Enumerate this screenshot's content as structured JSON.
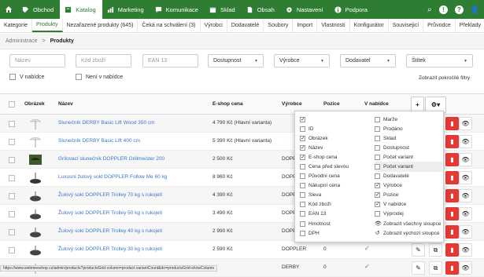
{
  "topnav": {
    "items": [
      {
        "label": "",
        "icon": "home-icon"
      },
      {
        "label": "Obchod",
        "icon": "tag-icon"
      },
      {
        "label": "Katalog",
        "icon": "book-icon",
        "active": true
      },
      {
        "label": "Marketing",
        "icon": "chart-icon"
      },
      {
        "label": "Komunikace",
        "icon": "chat-icon"
      },
      {
        "label": "Sklad",
        "icon": "box-icon"
      },
      {
        "label": "Obsah",
        "icon": "file-icon"
      },
      {
        "label": "Nastavení",
        "icon": "gear-icon"
      },
      {
        "label": "Podpora",
        "icon": "info-icon"
      }
    ],
    "right": [
      {
        "label": "Q",
        "icon": "search-icon"
      },
      {
        "label": "!",
        "icon": "alert-icon"
      },
      {
        "label": "?",
        "icon": "help-icon"
      },
      {
        "label": "👤",
        "icon": "user-icon"
      }
    ]
  },
  "subnav": {
    "items": [
      "Kategorie",
      "Produkty",
      "Nezařazené produkty (645)",
      "Čeká na schválení (3)",
      "Výrobci",
      "Dodavatelé",
      "Soubory",
      "Import",
      "Vlastnosti",
      "Konfigurátor",
      "Souvisejicí",
      "Průvodce",
      "Překlady"
    ],
    "active_index": 1
  },
  "breadcrumb": {
    "root": "Administrace",
    "sep": ">",
    "current": "Produkty"
  },
  "filters": {
    "name_placeholder": "Název",
    "code_placeholder": "Kód zboží",
    "ean_placeholder": "EAN 13",
    "availability": "Dostupnost",
    "manufacturer": "Výrobce",
    "supplier": "Dodavatel",
    "label": "Štítek",
    "in_offer": "V nabídce",
    "not_in_offer": "Není v nabídce",
    "advanced": "Zobrazit pokročilé filtry"
  },
  "table": {
    "headers": {
      "image": "Obrázek",
      "name": "Název",
      "price": "E-shop cena",
      "manufacturer": "Výrobce",
      "position": "Pozice",
      "in_offer": "V nabídce",
      "add": "+",
      "settings": "⚙▾"
    },
    "rows": [
      {
        "name": "Slunečník DERBY Basic Lift Wood 350 cm",
        "price": "4 790 Kč (Hlavní varianta)",
        "manufacturer": "",
        "position": "",
        "thumb": "parasol"
      },
      {
        "name": "Slunečník DERBY Basic Lift 400 cm",
        "price": "5 390 Kč (Hlavní varianta)",
        "manufacturer": "",
        "position": "",
        "thumb": "parasol"
      },
      {
        "name": "Grilovací slunečník DOPPLER Grillmeister 200",
        "price": "2 500 Kč",
        "manufacturer": "DOPPL",
        "position": "",
        "thumb": "grill"
      },
      {
        "name": "Luxusní žulový sokl DOPPLER Follow Me 60 kg",
        "price": "8 960 Kč",
        "manufacturer": "DOPPL",
        "position": "",
        "thumb": "base"
      },
      {
        "name": "Žulový sokl DOPPLER Trolley 70 kg s rukojetí",
        "price": "4 390 Kč",
        "manufacturer": "DOPPL",
        "position": "",
        "thumb": "base"
      },
      {
        "name": "Žulový sokl DOPPLER Trolley 50 kg s rukojetí",
        "price": "3 490 Kč",
        "manufacturer": "DOPPL",
        "position": "",
        "thumb": "base"
      },
      {
        "name": "Žulový sokl DOPPLER Trolley 40 kg s rukojetí",
        "price": "2 990 Kč",
        "manufacturer": "DOPPL",
        "position": "",
        "thumb": "base"
      },
      {
        "name": "Žulový sokl DOPPLER Trolley 30 kg s rukojetí",
        "price": "2 590 Kč",
        "manufacturer": "DOPPLER",
        "position": "0",
        "thumb": "base"
      },
      {
        "name": "",
        "price": "",
        "manufacturer": "DERBY",
        "position": "0",
        "thumb": "parasol"
      }
    ]
  },
  "columns_dropdown": {
    "left": [
      {
        "label": "",
        "checked": true
      },
      {
        "label": "ID",
        "checked": false
      },
      {
        "label": "Obrázek",
        "checked": true
      },
      {
        "label": "Název",
        "checked": true
      },
      {
        "label": "E-shop cena",
        "checked": true
      },
      {
        "label": "Cena před slevou",
        "checked": false
      },
      {
        "label": "Původní cena",
        "checked": false
      },
      {
        "label": "Nákupní cena",
        "checked": false
      },
      {
        "label": "Sleva",
        "checked": false
      },
      {
        "label": "Kód zboží",
        "checked": false
      },
      {
        "label": "EAN 13",
        "checked": false
      },
      {
        "label": "Hmotnost",
        "checked": false
      },
      {
        "label": "DPH",
        "checked": false
      }
    ],
    "right": [
      {
        "label": "Marže",
        "checked": false
      },
      {
        "label": "Prodáno",
        "checked": false
      },
      {
        "label": "Sklad",
        "checked": false
      },
      {
        "label": "Dostupnost",
        "checked": false
      },
      {
        "label": "Počet variant",
        "checked": false
      },
      {
        "label": "Počet variant",
        "checked": false,
        "highlight": true
      },
      {
        "label": "Dodavatelé",
        "checked": false
      },
      {
        "label": "Výrobce",
        "checked": true
      },
      {
        "label": "Pozice",
        "checked": true
      },
      {
        "label": "V nabídce",
        "checked": true
      },
      {
        "label": "Výprodej",
        "checked": false
      }
    ],
    "actions": [
      {
        "label": "Zobrazit všechny sloupce",
        "icon": "eye-icon"
      },
      {
        "label": "Zobrazit výchozí sloupce",
        "icon": "reset-icon"
      }
    ]
  },
  "statusbar": "https://www.webmeeshop.cz/admin/products?productsGrid-column=product.variantCount&do=productsGrid-showColumn"
}
